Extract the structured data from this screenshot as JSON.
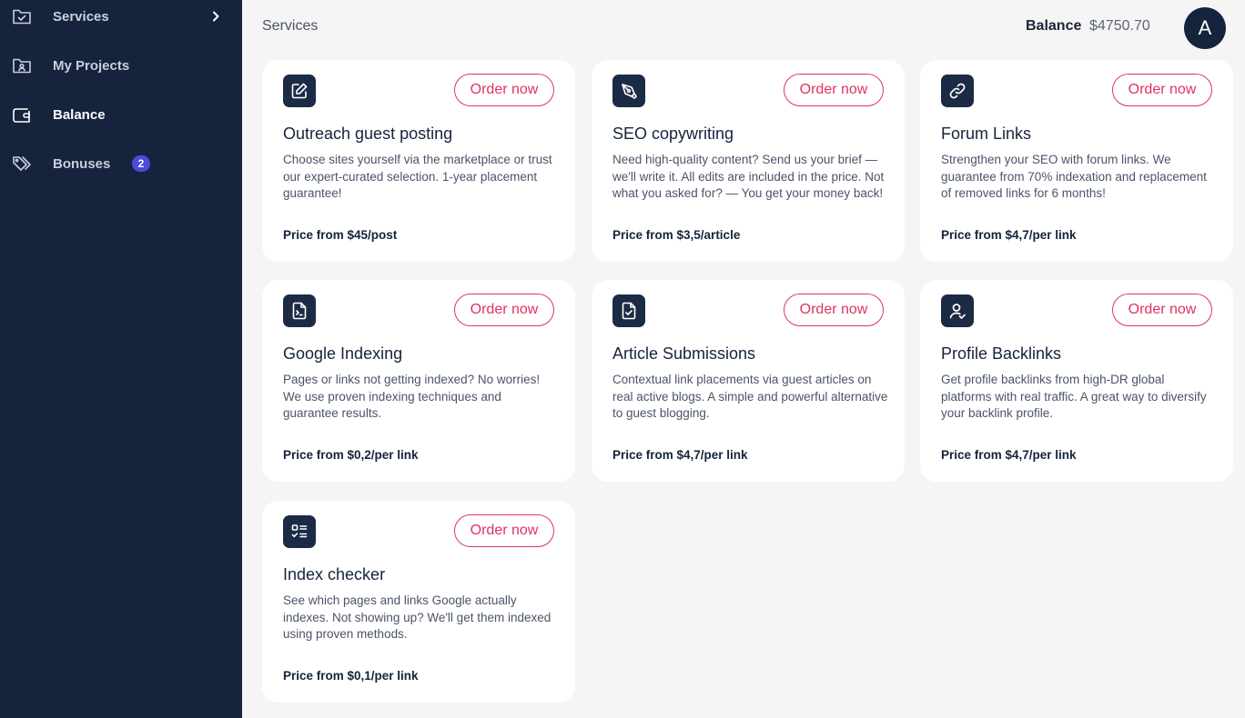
{
  "sidebar": {
    "items": [
      {
        "label": "Services",
        "icon": "folder-check-icon"
      },
      {
        "label": "My Projects",
        "icon": "folder-user-icon"
      },
      {
        "label": "Balance",
        "icon": "wallet-icon"
      },
      {
        "label": "Bonuses",
        "icon": "tags-icon",
        "badge": "2"
      }
    ]
  },
  "header": {
    "title": "Services",
    "balance_label": "Balance",
    "balance_value": "$4750.70",
    "avatar_initial": "A"
  },
  "cards": [
    {
      "icon": "edit-icon",
      "button": "Order now",
      "title": "Outreach guest posting",
      "description": "Choose sites yourself via the marketplace or trust our expert-curated selection. 1-year placement guarantee!",
      "price": "Price from $45/post"
    },
    {
      "icon": "pen-tool-icon",
      "button": "Order now",
      "title": "SEO copywriting",
      "description": "Need high-quality content? Send us your brief — we'll write it. All edits are included in the price. Not what you asked for? — You get your money back!",
      "price": "Price from $3,5/article"
    },
    {
      "icon": "link-icon",
      "button": "Order now",
      "title": "Forum Links",
      "description": "Strengthen your SEO with forum links. We guarantee from 70% indexation and replacement of removed links for 6 months!",
      "price": "Price from $4,7/per link"
    },
    {
      "icon": "terminal-file-icon",
      "button": "Order now",
      "title": "Google Indexing",
      "description": "Pages or links not getting indexed? No worries! We use proven indexing techniques and guarantee results.",
      "price": "Price from $0,2/per link"
    },
    {
      "icon": "file-check-icon",
      "button": "Order now",
      "title": "Article Submissions",
      "description": "Contextual link placements via guest articles on real active blogs. A simple and powerful alternative to guest blogging.",
      "price": "Price from $4,7/per link"
    },
    {
      "icon": "user-check-icon",
      "button": "Order now",
      "title": "Profile Backlinks",
      "description": "Get profile backlinks from high-DR global platforms with real traffic. A great way to diversify your backlink profile.",
      "price": "Price from $4,7/per link"
    },
    {
      "icon": "checklist-icon",
      "button": "Order now",
      "title": "Index checker",
      "description": "See which pages and links Google actually indexes. Not showing up? We'll get them indexed using proven methods.",
      "price": "Price from $0,1/per link"
    }
  ],
  "colors": {
    "sidebar_bg": "#16233d",
    "accent": "#e0335f",
    "badge": "#4a4cdb"
  }
}
